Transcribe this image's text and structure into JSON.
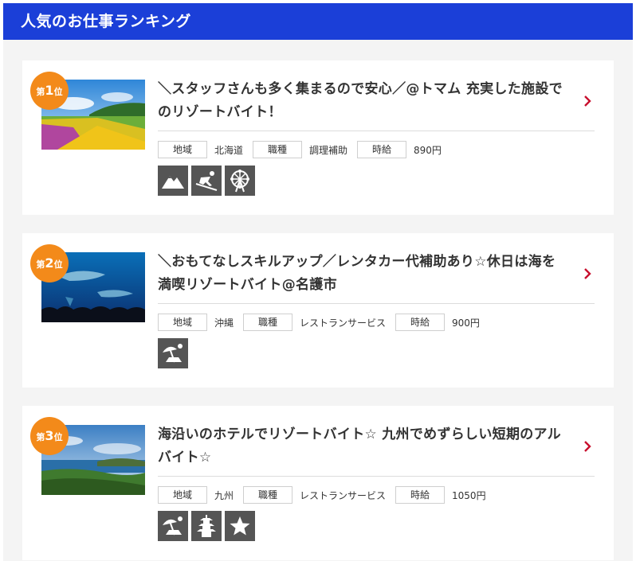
{
  "header": {
    "title": "人気のお仕事ランキング"
  },
  "labels": {
    "area": "地域",
    "job": "職種",
    "wage": "時給"
  },
  "badge": {
    "prefix": "第",
    "suffix": "位"
  },
  "jobs": [
    {
      "rank": "1",
      "title_line1": "＼スタッフさんも多く集まるので安心／@トマム 充実した施設で",
      "title_line2": "のリゾートバイト！",
      "area": "北海道",
      "job": "調理補助",
      "wage": "890円",
      "icons": [
        "mountain-icon",
        "ski-icon",
        "ferris-wheel-icon"
      ]
    },
    {
      "rank": "2",
      "title_line1": "＼おもてなしスキルアップ／レンタカー代補助あり☆休日は海を",
      "title_line2": "満喫リゾートバイト@名護市",
      "area": "沖縄",
      "job": "レストランサービス",
      "wage": "900円",
      "icons": [
        "beach-parasol-icon"
      ]
    },
    {
      "rank": "3",
      "title_line1": "海沿いのホテルでリゾートバイト☆ 九州でめずらしい短期のアル",
      "title_line2": "バイト☆",
      "area": "九州",
      "job": "レストランサービス",
      "wage": "1050円",
      "icons": [
        "beach-parasol-icon",
        "pagoda-icon",
        "star-icon"
      ]
    }
  ],
  "colors": {
    "header_bg": "#1b3fd8",
    "badge": "#f38a1a",
    "chevron": "#c8102e",
    "icon_bg": "#555555"
  }
}
